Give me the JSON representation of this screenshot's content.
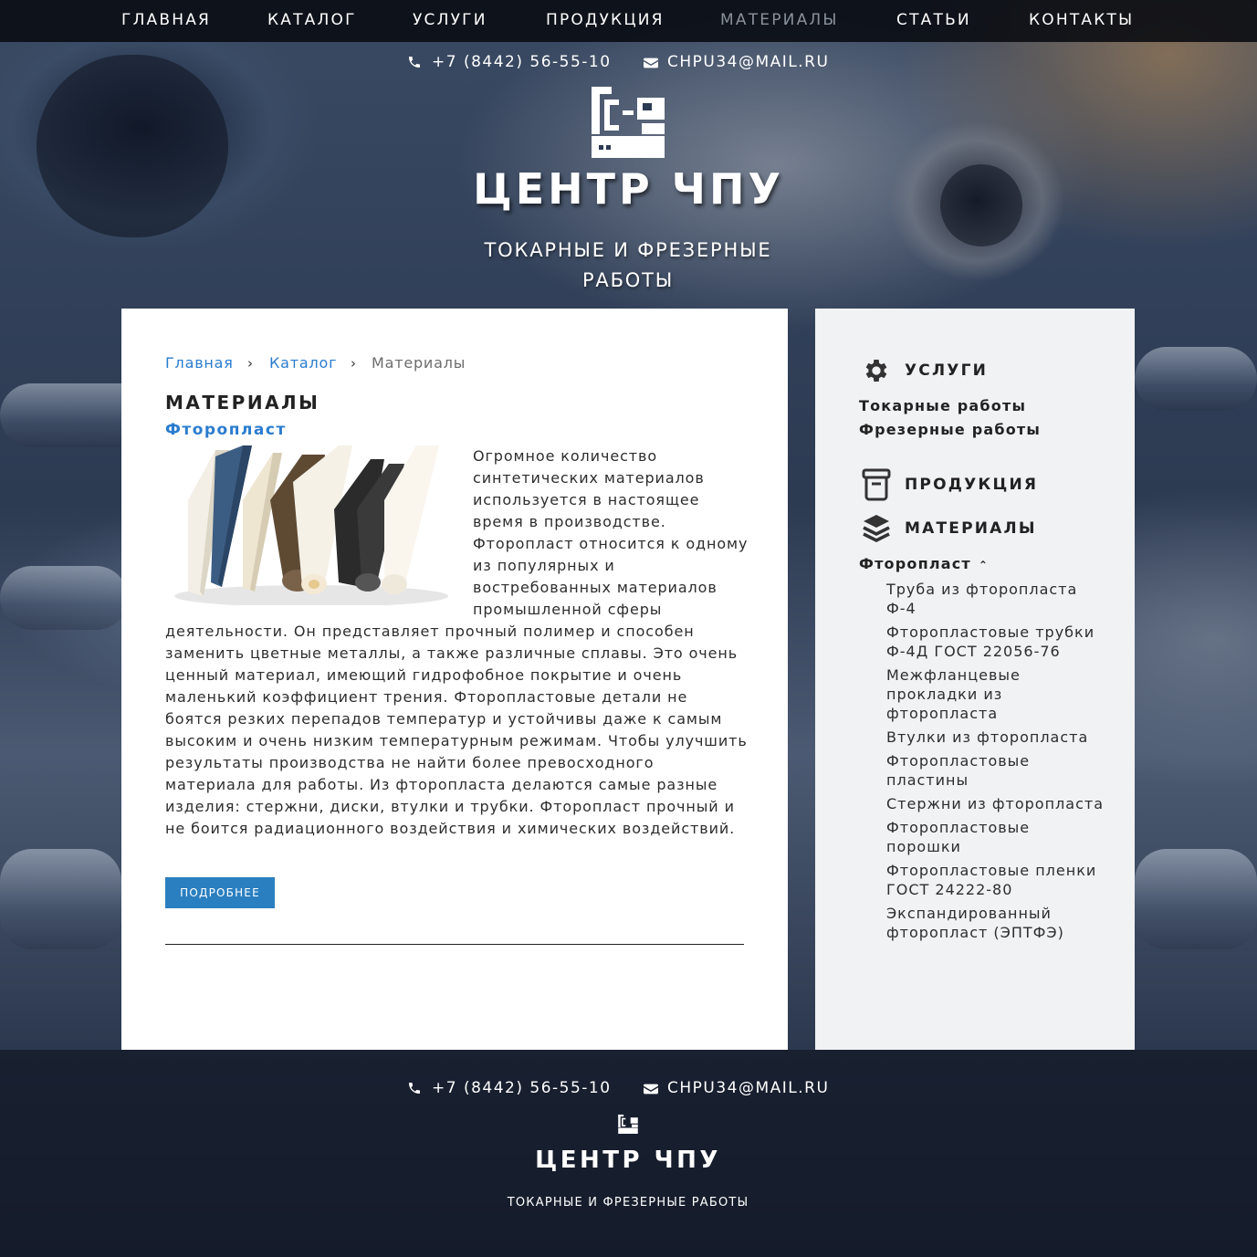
{
  "nav": {
    "items": [
      {
        "label": "ГЛАВНАЯ",
        "active": false
      },
      {
        "label": "КАТАЛОГ",
        "active": false
      },
      {
        "label": "УСЛУГИ",
        "active": false
      },
      {
        "label": "ПРОДУКЦИЯ",
        "active": false
      },
      {
        "label": "МАТЕРИАЛЫ",
        "active": true
      },
      {
        "label": "СТАТЬИ",
        "active": false
      },
      {
        "label": "КОНТАКТЫ",
        "active": false
      }
    ]
  },
  "header": {
    "phone": "+7 (8442) 56-55-10",
    "email": "CHPU34@MAIL.RU",
    "brand_title": "ЦЕНТР ЧПУ",
    "brand_subtitle": "ТОКАРНЫЕ И ФРЕЗЕРНЫЕ РАБОТЫ"
  },
  "breadcrumb": {
    "home": "Главная",
    "catalog": "Каталог",
    "current": "Материалы",
    "separator": "›"
  },
  "main": {
    "title": "МАТЕРИАЛЫ",
    "subtitle": "Фторопласт",
    "text": "Огромное количество синтетических материалов используется в настоящее время в производстве. Фторопласт относится к одному из популярных и востребованных материалов промышленной сферы деятельности. Он представляет прочный полимер и способен заменить цветные металлы, а также различные сплавы. Это очень ценный материал, имеющий гидрофобное покрытие и очень маленький коэффициент трения. Фторопластовые детали не боятся резких перепадов температур и устойчивы даже к самым высоким и очень низким температурным режимам. Чтобы улучшить результаты производства не найти более превосходного материала для работы. Из фторопласта делаются самые разные изделия: стержни, диски, втулки и трубки. Фторопласт прочный и не боится радиационного воздействия и химических воздействий.",
    "more_button": "ПОДРОБНЕЕ"
  },
  "sidebar": {
    "services_heading": "УСЛУГИ",
    "services": [
      "Токарные работы",
      "Фрезерные работы"
    ],
    "products_heading": "ПРОДУКЦИЯ",
    "materials_heading": "МАТЕРИАЛЫ",
    "group_label": "Фторопласт",
    "group_expanded": true,
    "group_items": [
      "Труба из фторопласта Ф-4",
      "Фторопластовые трубки Ф-4Д ГОСТ 22056-76",
      "Межфланцевые прокладки из фторопласта",
      "Втулки из фторопласта",
      "Фторопластовые пластины",
      "Стержни из фторопласта",
      "Фторопластовые порошки",
      "Фторопластовые пленки ГОСТ 24222-80",
      "Экспандированный фторопласт (ЭПТФЭ)"
    ]
  },
  "footer": {
    "phone": "+7 (8442) 56-55-10",
    "email": "CHPU34@MAIL.RU",
    "brand_title": "ЦЕНТР ЧПУ",
    "brand_subtitle": "ТОКАРНЫЕ И ФРЕЗЕРНЫЕ РАБОТЫ"
  },
  "colors": {
    "accent": "#2a7ccf",
    "button": "#2a7fc0",
    "nav_bg": "#08090f",
    "nav_active": "#8a919c",
    "sidebar_bg": "#f1f2f4"
  },
  "icons": {
    "phone": "phone-icon",
    "email": "envelope-icon",
    "services": "gear-icon",
    "products": "box-icon",
    "materials": "layers-icon",
    "group_toggle": "chevron-up-icon"
  }
}
